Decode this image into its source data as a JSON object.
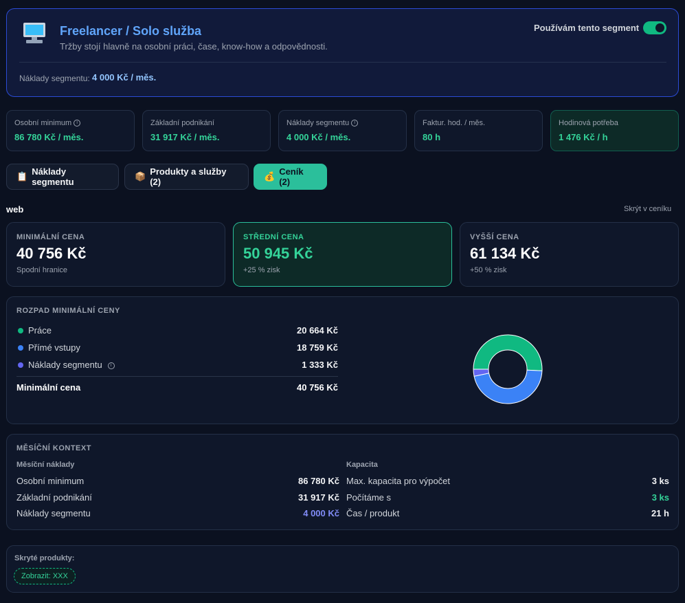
{
  "header": {
    "title": "Freelancer / Solo služba",
    "subtitle": "Tržby stojí hlavně na osobní práci, čase, know-how a odpovědnosti.",
    "toggle_label": "Používám tento segment",
    "toggle_on": true,
    "cost_label": "Náklady segmentu:",
    "cost_value": "4 000 Kč / měs."
  },
  "stats": [
    {
      "label": "Osobní minimum",
      "value": "86 780 Kč / měs.",
      "info": true
    },
    {
      "label": "Základní podnikání",
      "value": "31 917 Kč / měs."
    },
    {
      "label": "Náklady segmentu",
      "value": "4 000 Kč / měs.",
      "info": true
    },
    {
      "label": "Faktur. hod. / měs.",
      "value": "80 h"
    },
    {
      "label": "Hodinová potřeba",
      "value": "1 476 Kč / h"
    }
  ],
  "tabs": [
    {
      "icon": "📋",
      "label": "Náklady segmentu"
    },
    {
      "icon": "📦",
      "label": "Produkty a služby (2)"
    },
    {
      "icon": "💰",
      "label": "Ceník (2)"
    }
  ],
  "product": {
    "name": "web",
    "hide_label": "Skrýt v ceníku"
  },
  "prices": [
    {
      "title": "MINIMÁLNÍ CENA",
      "value": "40 756 Kč",
      "sub": "Spodní hranice"
    },
    {
      "title": "STŘEDNÍ CENA",
      "value": "50 945 Kč",
      "sub": "+25 % zisk"
    },
    {
      "title": "VYŠŠÍ CENA",
      "value": "61 134 Kč",
      "sub": "+50 % zisk"
    }
  ],
  "breakdown": {
    "title": "ROZPAD MINIMÁLNÍ CENY",
    "items": [
      {
        "label": "Práce",
        "value": "20 664 Kč",
        "amount": 20664,
        "color": "#10b981"
      },
      {
        "label": "Přímé vstupy",
        "value": "18 759 Kč",
        "amount": 18759,
        "color": "#3b82f6"
      },
      {
        "label": "Náklady segmentu",
        "value": "1 333 Kč",
        "amount": 1333,
        "color": "#6366f1",
        "info": true
      }
    ],
    "total_label": "Minimální cena",
    "total_value": "40 756 Kč"
  },
  "monthly": {
    "title": "MĚSÍČNÍ KONTEXT",
    "costs_heading": "Měsíční náklady",
    "costs": [
      {
        "label": "Osobní minimum",
        "value": "86 780 Kč"
      },
      {
        "label": "Základní podnikání",
        "value": "31 917 Kč"
      },
      {
        "label": "Náklady segmentu",
        "value": "4 000 Kč",
        "accent": "#818cf8"
      }
    ],
    "capacity_heading": "Kapacita",
    "capacity": [
      {
        "label": "Max. kapacita pro výpočet",
        "value": "3 ks"
      },
      {
        "label": "Počítáme s",
        "value": "3 ks",
        "accent": "#34d399"
      },
      {
        "label": "Čas / produkt",
        "value": "21 h"
      }
    ]
  },
  "hidden_products": {
    "title": "Skryté produkty:",
    "chip_label": "Zobrazit: XXX"
  },
  "colors": {
    "accent": "#2bbf9b",
    "green": "#10b981",
    "blue": "#3b82f6",
    "indigo": "#6366f1"
  }
}
